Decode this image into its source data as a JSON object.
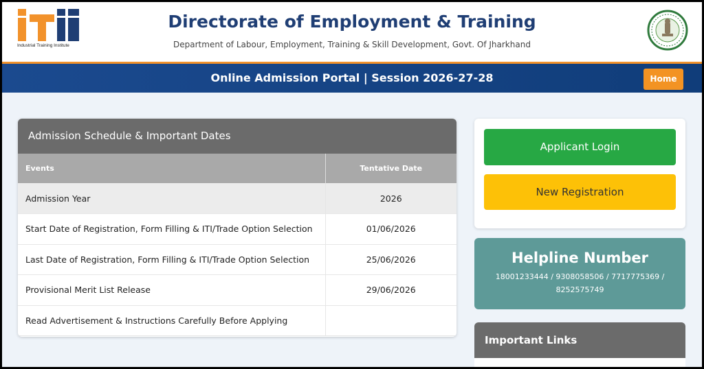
{
  "header": {
    "logo_caption": "Industrial Training Institute",
    "title": "Directorate of Employment & Training",
    "subtitle": "Department of Labour, Employment, Training & Skill Development, Govt. Of Jharkhand"
  },
  "banner": {
    "text": "Online Admission Portal | Session 2026-27-28",
    "home_label": "Home"
  },
  "schedule": {
    "heading": "Admission Schedule & Important Dates",
    "columns": [
      "Events",
      "Tentative Date"
    ],
    "rows": [
      {
        "event": "Admission Year",
        "date": "2026"
      },
      {
        "event": "Start Date of Registration, Form Filling & ITI/Trade Option Selection",
        "date": "01/06/2026"
      },
      {
        "event": "Last Date of Registration, Form Filling & ITI/Trade Option Selection",
        "date": "25/06/2026"
      },
      {
        "event": "Provisional Merit List Release",
        "date": "29/06/2026"
      },
      {
        "event": "Read Advertisement & Instructions Carefully Before Applying",
        "date": ""
      }
    ]
  },
  "sidebar": {
    "login_label": "Applicant Login",
    "register_label": "New Registration",
    "helpline_title": "Helpline Number",
    "helpline_numbers": "18001233444 / 9308058506 / 7717775369 / 8252575749",
    "links_heading": "Important Links"
  },
  "colors": {
    "brand_blue": "#1f3e74",
    "banner_blue": "#103d7a",
    "accent_orange": "#f39323",
    "login_green": "#27a844",
    "register_yellow": "#fdc107",
    "helpline_teal": "#5e9a98"
  },
  "icons": {
    "logo": "iti-logo",
    "emblem": "jharkhand-state-emblem"
  }
}
